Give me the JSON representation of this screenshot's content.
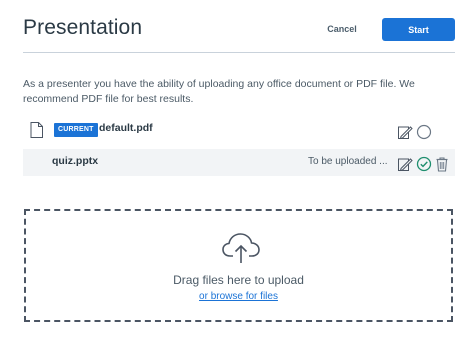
{
  "header": {
    "title": "Presentation",
    "cancel_label": "Cancel",
    "start_label": "Start"
  },
  "description": "As a presenter you have the ability of uploading any office document or PDF file. We recommend PDF file for best results.",
  "files": [
    {
      "badge": "CURRENT",
      "name": "default.pdf",
      "status": "",
      "selected": false
    },
    {
      "badge": "",
      "name": "quiz.pptx",
      "status": "To be uploaded ...",
      "selected": true
    }
  ],
  "dropzone": {
    "text": "Drag files here to upload",
    "browse_link": "or browse for files"
  },
  "colors": {
    "primary": "#1b73d6",
    "success": "#1e8e6e",
    "divider": "#c9d2db",
    "row_highlight": "#f2f4f6"
  },
  "icons": {
    "file": "file-icon",
    "edit": "edit-icon",
    "radio": "radio-unchecked-icon",
    "check": "check-circle-icon",
    "trash": "trash-icon",
    "upload": "cloud-upload-icon"
  }
}
